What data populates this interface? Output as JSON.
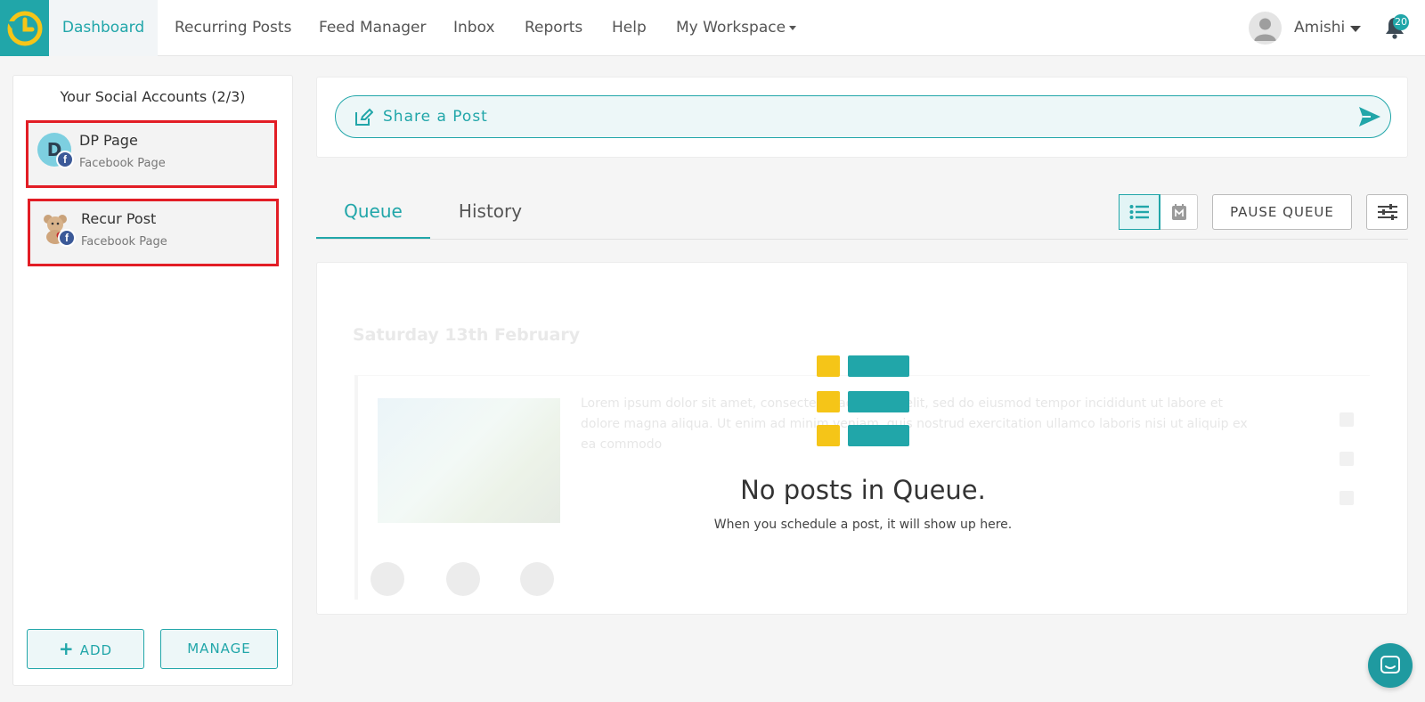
{
  "nav": {
    "items": [
      {
        "label": "Dashboard",
        "active": true
      },
      {
        "label": "Recurring Posts",
        "active": false
      },
      {
        "label": "Feed Manager",
        "active": false
      },
      {
        "label": "Inbox",
        "active": false
      },
      {
        "label": "Reports",
        "active": false
      },
      {
        "label": "Help",
        "active": false
      },
      {
        "label": "My Workspace",
        "active": false
      }
    ],
    "user_name": "Amishi",
    "notification_count": "20"
  },
  "sidebar": {
    "title": "Your Social Accounts (2/3)",
    "accounts": [
      {
        "initial": "D",
        "name": "DP Page",
        "type": "Facebook Page"
      },
      {
        "initial": "",
        "name": "Recur Post",
        "type": "Facebook Page"
      }
    ],
    "add_label": "ADD",
    "manage_label": "MANAGE"
  },
  "share": {
    "label": "Share a Post"
  },
  "tabs": [
    {
      "label": "Queue",
      "active": true
    },
    {
      "label": "History",
      "active": false
    }
  ],
  "toolbar": {
    "pause_label": "PAUSE QUEUE"
  },
  "queue": {
    "ghost_date": "Saturday 13th February",
    "ghost_text": "Lorem ipsum dolor sit amet, consectetur adipiscing elit, sed do eiusmod tempor incididunt ut labore et dolore magna aliqua. Ut enim ad minim veniam, quis nostrud exercitation ullamco laboris nisi ut aliquip ex ea commodo",
    "empty_title": "No posts in Queue.",
    "empty_subtitle": "When you schedule a post, it will show up here."
  },
  "colors": {
    "accent": "#21a6a9",
    "highlight": "#e21d25",
    "icon_yellow": "#f5c518",
    "facebook": "#3b5998"
  }
}
